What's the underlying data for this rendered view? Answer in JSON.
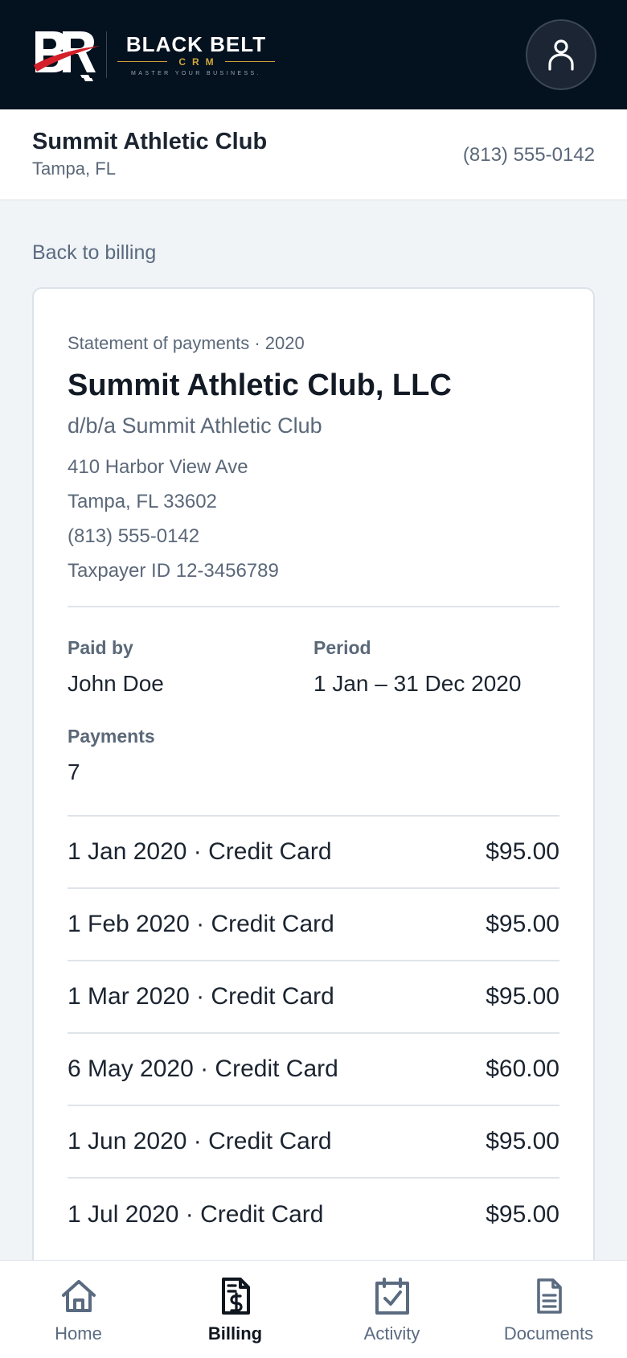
{
  "brand": {
    "name": "BLACK BELT",
    "sub": "CRM",
    "tagline": "MASTER YOUR BUSINESS."
  },
  "account": {
    "name": "Summit Athletic Club",
    "location": "Tampa, FL",
    "phone": "(813) 555-0142"
  },
  "back_label": "Back to billing",
  "statement": {
    "label": "Statement of payments · 2020",
    "business_name": "Summit Athletic Club, LLC",
    "dba": "d/b/a Summit Athletic Club",
    "address": [
      "410 Harbor View Ave",
      "Tampa, FL 33602",
      "(813) 555-0142",
      "Taxpayer ID 12-3456789"
    ],
    "paid_by_label": "Paid by",
    "paid_by": "John Doe",
    "period_label": "Period",
    "period": "1 Jan – 31 Dec 2020",
    "payments_label": "Payments",
    "payments_count": "7",
    "payments": [
      {
        "desc": "1 Jan 2020 · Credit Card",
        "amount": "$95.00"
      },
      {
        "desc": "1 Feb 2020 · Credit Card",
        "amount": "$95.00"
      },
      {
        "desc": "1 Mar 2020 · Credit Card",
        "amount": "$95.00"
      },
      {
        "desc": "6 May 2020 · Credit Card",
        "amount": "$60.00"
      },
      {
        "desc": "1 Jun 2020 · Credit Card",
        "amount": "$95.00"
      },
      {
        "desc": "1 Jul 2020 · Credit Card",
        "amount": "$95.00"
      }
    ]
  },
  "nav": [
    {
      "label": "Home",
      "icon": "home-icon",
      "active": false
    },
    {
      "label": "Billing",
      "icon": "invoice-dollar-icon",
      "active": true
    },
    {
      "label": "Activity",
      "icon": "calendar-check-icon",
      "active": false
    },
    {
      "label": "Documents",
      "icon": "document-icon",
      "active": false
    }
  ],
  "colors": {
    "header_bg": "#04111f",
    "accent_gold": "#d1a73d",
    "logo_red": "#d4202a"
  }
}
